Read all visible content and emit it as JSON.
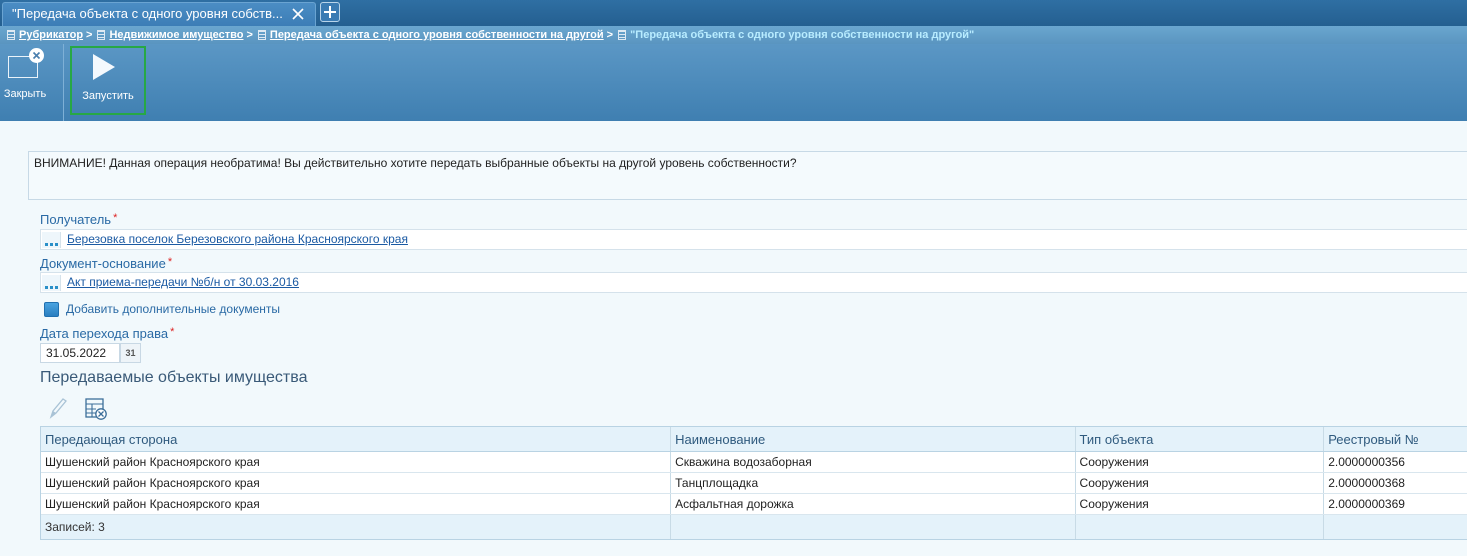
{
  "tab": {
    "title": "\"Передача объекта с одного уровня собств..."
  },
  "breadcrumb": {
    "items": [
      "Рубрикатор",
      "Недвижимое имущество",
      "Передача объекта с одного уровня собственности на другой"
    ],
    "current": "\"Передача объекта с одного уровня собственности на другой\"",
    "separator": ">"
  },
  "toolbar": {
    "close_label": "Закрыть",
    "run_label": "Запустить"
  },
  "warning": {
    "text": "ВНИМАНИЕ! Данная операция необратима! Вы действительно хотите передать выбранные объекты на другой уровень собственности?"
  },
  "recipient": {
    "label": "Получатель",
    "required_mark": "*",
    "value": "Березовка поселок Березовского района Красноярского края"
  },
  "base_document": {
    "label": "Документ-основание",
    "required_mark": "*",
    "value": "Акт приема-передачи №б/н от 30.03.2016"
  },
  "add_documents": {
    "label": "Добавить дополнительные документы"
  },
  "transfer_date": {
    "label": "Дата перехода права",
    "required_mark": "*",
    "value": "31.05.2022",
    "calendar_glyph": "31"
  },
  "objects_section": {
    "title": "Передаваемые объекты имущества"
  },
  "grid": {
    "columns": [
      "Передающая сторона",
      "Наименование",
      "Тип объекта",
      "Реестровый №"
    ],
    "rows": [
      [
        "Шушенский район Красноярского края",
        "Скважина водозаборная",
        "Сооружения",
        "2.0000000356"
      ],
      [
        "Шушенский район Красноярского края",
        "Танцплощадка",
        "Сооружения",
        "2.0000000368"
      ],
      [
        "Шушенский район Красноярского края",
        "Асфальтная дорожка",
        "Сооружения",
        "2.0000000369"
      ]
    ],
    "footer": "Записей: 3"
  },
  "colors": {
    "accent": "#2a6aa5",
    "toolbar": "#4a8aba",
    "highlight": "#27a845",
    "required": "#dd2222"
  }
}
